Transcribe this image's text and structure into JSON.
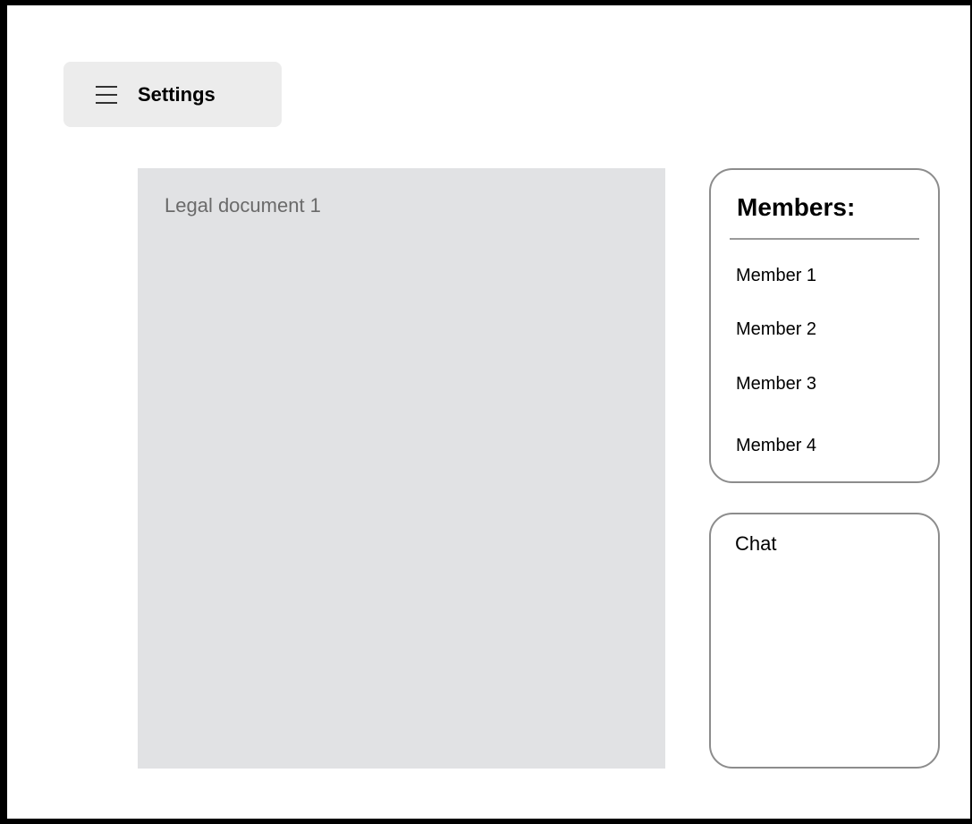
{
  "header": {
    "menu_icon": "hamburger-menu-icon",
    "settings_label": "Settings"
  },
  "document": {
    "title": "Legal document 1"
  },
  "members": {
    "heading": "Members:",
    "items": [
      {
        "label": "Member 1"
      },
      {
        "label": "Member 2"
      },
      {
        "label": "Member 3"
      },
      {
        "label": "Member 4"
      }
    ]
  },
  "chat": {
    "label": "Chat"
  },
  "colors": {
    "frame_border": "#000000",
    "settings_button_bg": "#ececec",
    "document_bg": "#e1e2e4",
    "document_title_text": "#6a6a6a",
    "card_border": "#8c8c8c"
  }
}
